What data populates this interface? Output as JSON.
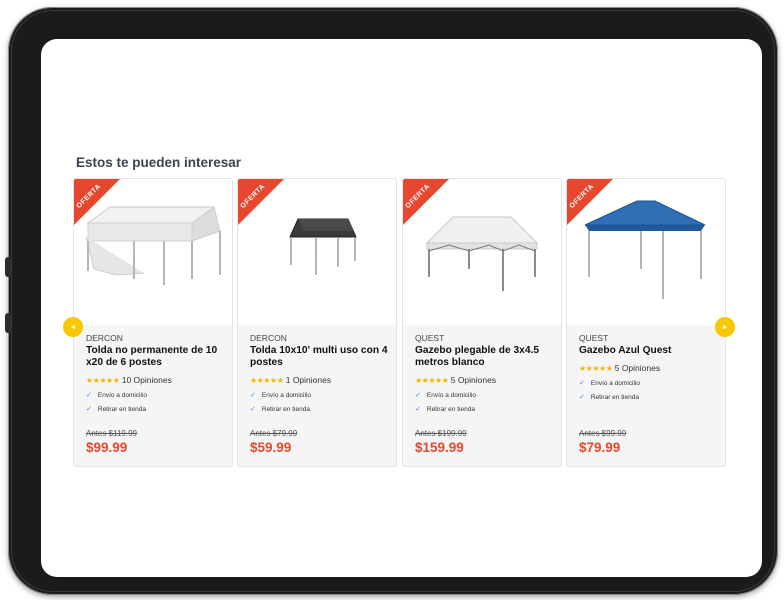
{
  "section": {
    "title": "Estos te pueden interesar"
  },
  "ribbon_label": "OFERTA",
  "colors": {
    "accent": "#e8472f",
    "nav_arrow": "#f7c800",
    "star": "#f5b301",
    "check": "#3a86e8"
  },
  "products": [
    {
      "brand": "DERCON",
      "name_line1": "Tolda no permanente de 10",
      "name_line2": "x20 de 6 postes",
      "stars": "★★★★★",
      "reviews": "10 Opiniones",
      "feature1": "Envío a domicilio",
      "feature2": "Retirar en tienda",
      "old_price": "Antes $119.99",
      "price": "$99.99"
    },
    {
      "brand": "DERCON",
      "name_line1": "Tolda 10x10' multi uso con 4",
      "name_line2": "postes",
      "stars": "★★★★★",
      "reviews": "1 Opiniones",
      "feature1": "Envío a domicilio",
      "feature2": "Retirar en tienda",
      "old_price": "Antes $79.99",
      "price": "$59.99"
    },
    {
      "brand": "QUEST",
      "name_line1": "Gazebo plegable de 3x4.5",
      "name_line2": "metros blanco",
      "stars": "★★★★★",
      "reviews": "5 Opiniones",
      "feature1": "Envío a domicilio",
      "feature2": "Retirar en tienda",
      "old_price": "Antes $199.99",
      "price": "$159.99"
    },
    {
      "brand": "QUEST",
      "name_line1": "Gazebo Azul Quest",
      "name_line2": "",
      "stars": "★★★★★",
      "reviews": "5 Opiniones",
      "feature1": "Envío a domicilio",
      "feature2": "Retirar en tienda",
      "old_price": "Antes $99.99",
      "price": "$79.99"
    }
  ],
  "nav": {
    "prev_icon": "◄",
    "next_icon": "►"
  }
}
